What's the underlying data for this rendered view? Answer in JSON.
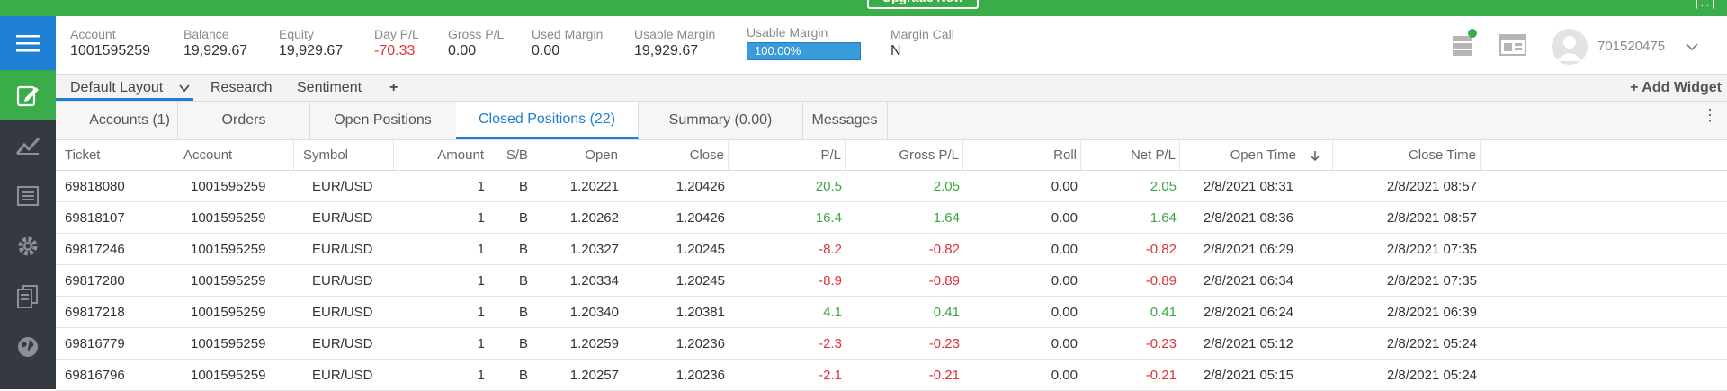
{
  "topbar": {
    "upgrade_label": "Upgrade Now",
    "right_text": "| ... |"
  },
  "colors": {
    "brand_green": "#3aad4a",
    "accent_blue": "#1e7fd4",
    "negative": "#e0313c",
    "positive": "#3aa840",
    "sidebar_bg": "#353a40"
  },
  "sidebar": {
    "items": [
      {
        "icon": "hamburger-menu-icon"
      },
      {
        "icon": "edit-note-icon"
      },
      {
        "icon": "chart-trend-icon"
      },
      {
        "icon": "list-document-icon"
      },
      {
        "icon": "gear-icon"
      },
      {
        "icon": "reports-copy-icon"
      },
      {
        "icon": "globe-icon"
      }
    ]
  },
  "account": {
    "metrics": [
      {
        "label": "Account",
        "value": "1001595259"
      },
      {
        "label": "Balance",
        "value": "19,929.67"
      },
      {
        "label": "Equity",
        "value": "19,929.67"
      },
      {
        "label": "Day P/L",
        "value": "-70.33"
      },
      {
        "label": "Gross P/L",
        "value": "0.00"
      },
      {
        "label": "Used Margin",
        "value": "0.00"
      },
      {
        "label": "Usable Margin",
        "value": "19,929.67"
      },
      {
        "label": "Usable Margin",
        "value": "100.00%"
      },
      {
        "label": "Margin Call",
        "value": "N"
      }
    ],
    "usable_margin_fill": 1.0,
    "user_id": "701520475"
  },
  "layout_tabs": [
    "Default Layout",
    "Research",
    "Sentiment",
    "+"
  ],
  "add_widget_label": "+ Add Widget",
  "widget_tabs": [
    "Accounts (1)",
    "Orders",
    "Open Positions",
    "Closed Positions (22)",
    "Summary (0.00)",
    "Messages"
  ],
  "table": {
    "columns": [
      "Ticket",
      "Account",
      "Symbol",
      "Amount",
      "S/B",
      "Open",
      "Close",
      "P/L",
      "Gross P/L",
      "Roll",
      "Net P/L",
      "Open Time",
      "Close Time"
    ],
    "sort_icon": "arrow-down-icon",
    "rows": [
      [
        "69818080",
        "1001595259",
        "EUR/USD",
        "1",
        "B",
        "1.20221",
        "1.20426",
        "20.5",
        "2.05",
        "0.00",
        "2.05",
        "2/8/2021 08:31",
        "2/8/2021 08:57"
      ],
      [
        "69818107",
        "1001595259",
        "EUR/USD",
        "1",
        "B",
        "1.20262",
        "1.20426",
        "16.4",
        "1.64",
        "0.00",
        "1.64",
        "2/8/2021 08:36",
        "2/8/2021 08:57"
      ],
      [
        "69817246",
        "1001595259",
        "EUR/USD",
        "1",
        "B",
        "1.20327",
        "1.20245",
        "-8.2",
        "-0.82",
        "0.00",
        "-0.82",
        "2/8/2021 06:29",
        "2/8/2021 07:35"
      ],
      [
        "69817280",
        "1001595259",
        "EUR/USD",
        "1",
        "B",
        "1.20334",
        "1.20245",
        "-8.9",
        "-0.89",
        "0.00",
        "-0.89",
        "2/8/2021 06:34",
        "2/8/2021 07:35"
      ],
      [
        "69817218",
        "1001595259",
        "EUR/USD",
        "1",
        "B",
        "1.20340",
        "1.20381",
        "4.1",
        "0.41",
        "0.00",
        "0.41",
        "2/8/2021 06:24",
        "2/8/2021 06:39"
      ],
      [
        "69816779",
        "1001595259",
        "EUR/USD",
        "1",
        "B",
        "1.20259",
        "1.20236",
        "-2.3",
        "-0.23",
        "0.00",
        "-0.23",
        "2/8/2021 05:12",
        "2/8/2021 05:24"
      ],
      [
        "69816796",
        "1001595259",
        "EUR/USD",
        "1",
        "B",
        "1.20257",
        "1.20236",
        "-2.1",
        "-0.21",
        "0.00",
        "-0.21",
        "2/8/2021 05:15",
        "2/8/2021 05:24"
      ]
    ]
  }
}
